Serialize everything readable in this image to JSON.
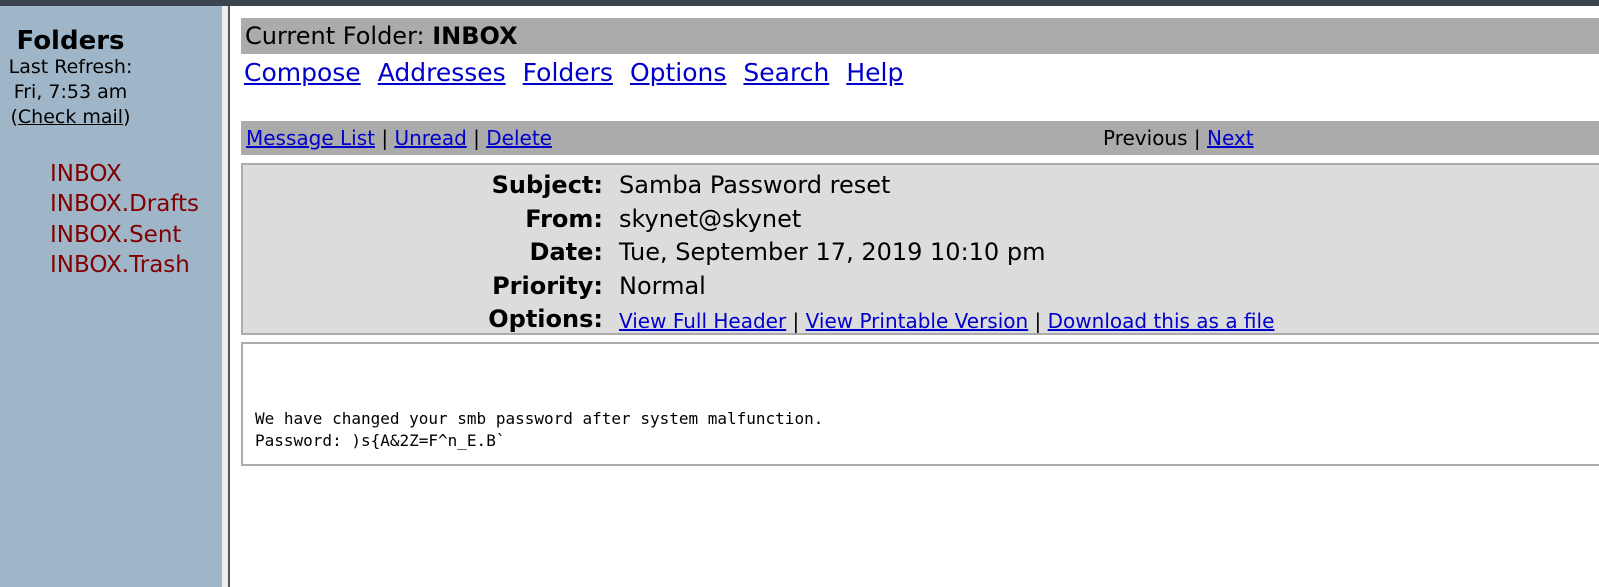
{
  "sidebar": {
    "title": "Folders",
    "last_refresh_label": "Last Refresh:",
    "last_refresh_time": "Fri, 7:53 am",
    "check_mail_open": "(",
    "check_mail_label": "Check mail",
    "check_mail_close": ")",
    "folders": [
      "INBOX",
      "INBOX.Drafts",
      "INBOX.Sent",
      "INBOX.Trash"
    ]
  },
  "header": {
    "current_folder_label": "Current Folder: ",
    "current_folder_name": "INBOX"
  },
  "nav": {
    "compose": "Compose",
    "addresses": "Addresses",
    "folders": "Folders",
    "options": "Options",
    "search": "Search",
    "help": "Help"
  },
  "toolbar": {
    "message_list": "Message List",
    "unread": "Unread",
    "delete": "Delete",
    "separator": " | ",
    "previous": "Previous",
    "next": "Next"
  },
  "message": {
    "subject_label": "Subject:",
    "subject": "Samba Password reset",
    "from_label": "From:",
    "from": "skynet@skynet",
    "date_label": "Date:",
    "date": "Tue, September 17, 2019 10:10 pm",
    "priority_label": "Priority:",
    "priority": "Normal",
    "options_label": "Options:",
    "view_full_header": "View Full Header",
    "view_printable": "View Printable Version",
    "download": "Download this as a file",
    "opt_sep": " | ",
    "body": "We have changed your smb password after system malfunction.\nPassword: )s{A&2Z=F^n_E.B`"
  },
  "colors": {
    "sidebar_bg": "#9fb6c9",
    "folder_link": "#800000",
    "link": "#0000cc",
    "bar_gray": "#ababab",
    "header_box_bg": "#dcdcdc"
  }
}
